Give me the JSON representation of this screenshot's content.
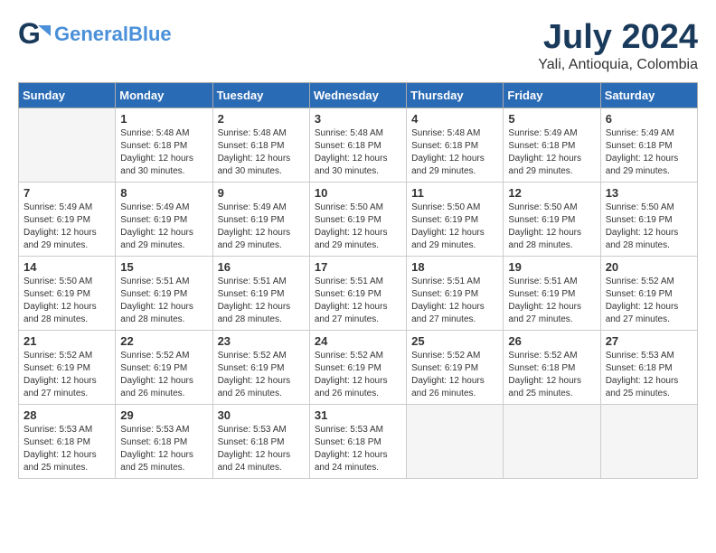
{
  "header": {
    "logo_line1": "General",
    "logo_line2": "Blue",
    "month_year": "July 2024",
    "location": "Yali, Antioquia, Colombia"
  },
  "weekdays": [
    "Sunday",
    "Monday",
    "Tuesday",
    "Wednesday",
    "Thursday",
    "Friday",
    "Saturday"
  ],
  "weeks": [
    [
      {
        "day": "",
        "empty": true
      },
      {
        "day": "1",
        "sunrise": "5:48 AM",
        "sunset": "6:18 PM",
        "daylight": "12 hours and 30 minutes."
      },
      {
        "day": "2",
        "sunrise": "5:48 AM",
        "sunset": "6:18 PM",
        "daylight": "12 hours and 30 minutes."
      },
      {
        "day": "3",
        "sunrise": "5:48 AM",
        "sunset": "6:18 PM",
        "daylight": "12 hours and 30 minutes."
      },
      {
        "day": "4",
        "sunrise": "5:48 AM",
        "sunset": "6:18 PM",
        "daylight": "12 hours and 29 minutes."
      },
      {
        "day": "5",
        "sunrise": "5:49 AM",
        "sunset": "6:18 PM",
        "daylight": "12 hours and 29 minutes."
      },
      {
        "day": "6",
        "sunrise": "5:49 AM",
        "sunset": "6:18 PM",
        "daylight": "12 hours and 29 minutes."
      }
    ],
    [
      {
        "day": "7",
        "sunrise": "5:49 AM",
        "sunset": "6:19 PM",
        "daylight": "12 hours and 29 minutes."
      },
      {
        "day": "8",
        "sunrise": "5:49 AM",
        "sunset": "6:19 PM",
        "daylight": "12 hours and 29 minutes."
      },
      {
        "day": "9",
        "sunrise": "5:49 AM",
        "sunset": "6:19 PM",
        "daylight": "12 hours and 29 minutes."
      },
      {
        "day": "10",
        "sunrise": "5:50 AM",
        "sunset": "6:19 PM",
        "daylight": "12 hours and 29 minutes."
      },
      {
        "day": "11",
        "sunrise": "5:50 AM",
        "sunset": "6:19 PM",
        "daylight": "12 hours and 29 minutes."
      },
      {
        "day": "12",
        "sunrise": "5:50 AM",
        "sunset": "6:19 PM",
        "daylight": "12 hours and 28 minutes."
      },
      {
        "day": "13",
        "sunrise": "5:50 AM",
        "sunset": "6:19 PM",
        "daylight": "12 hours and 28 minutes."
      }
    ],
    [
      {
        "day": "14",
        "sunrise": "5:50 AM",
        "sunset": "6:19 PM",
        "daylight": "12 hours and 28 minutes."
      },
      {
        "day": "15",
        "sunrise": "5:51 AM",
        "sunset": "6:19 PM",
        "daylight": "12 hours and 28 minutes."
      },
      {
        "day": "16",
        "sunrise": "5:51 AM",
        "sunset": "6:19 PM",
        "daylight": "12 hours and 28 minutes."
      },
      {
        "day": "17",
        "sunrise": "5:51 AM",
        "sunset": "6:19 PM",
        "daylight": "12 hours and 27 minutes."
      },
      {
        "day": "18",
        "sunrise": "5:51 AM",
        "sunset": "6:19 PM",
        "daylight": "12 hours and 27 minutes."
      },
      {
        "day": "19",
        "sunrise": "5:51 AM",
        "sunset": "6:19 PM",
        "daylight": "12 hours and 27 minutes."
      },
      {
        "day": "20",
        "sunrise": "5:52 AM",
        "sunset": "6:19 PM",
        "daylight": "12 hours and 27 minutes."
      }
    ],
    [
      {
        "day": "21",
        "sunrise": "5:52 AM",
        "sunset": "6:19 PM",
        "daylight": "12 hours and 27 minutes."
      },
      {
        "day": "22",
        "sunrise": "5:52 AM",
        "sunset": "6:19 PM",
        "daylight": "12 hours and 26 minutes."
      },
      {
        "day": "23",
        "sunrise": "5:52 AM",
        "sunset": "6:19 PM",
        "daylight": "12 hours and 26 minutes."
      },
      {
        "day": "24",
        "sunrise": "5:52 AM",
        "sunset": "6:19 PM",
        "daylight": "12 hours and 26 minutes."
      },
      {
        "day": "25",
        "sunrise": "5:52 AM",
        "sunset": "6:19 PM",
        "daylight": "12 hours and 26 minutes."
      },
      {
        "day": "26",
        "sunrise": "5:52 AM",
        "sunset": "6:18 PM",
        "daylight": "12 hours and 25 minutes."
      },
      {
        "day": "27",
        "sunrise": "5:53 AM",
        "sunset": "6:18 PM",
        "daylight": "12 hours and 25 minutes."
      }
    ],
    [
      {
        "day": "28",
        "sunrise": "5:53 AM",
        "sunset": "6:18 PM",
        "daylight": "12 hours and 25 minutes."
      },
      {
        "day": "29",
        "sunrise": "5:53 AM",
        "sunset": "6:18 PM",
        "daylight": "12 hours and 25 minutes."
      },
      {
        "day": "30",
        "sunrise": "5:53 AM",
        "sunset": "6:18 PM",
        "daylight": "12 hours and 24 minutes."
      },
      {
        "day": "31",
        "sunrise": "5:53 AM",
        "sunset": "6:18 PM",
        "daylight": "12 hours and 24 minutes."
      },
      {
        "day": "",
        "empty": true
      },
      {
        "day": "",
        "empty": true
      },
      {
        "day": "",
        "empty": true
      }
    ]
  ]
}
